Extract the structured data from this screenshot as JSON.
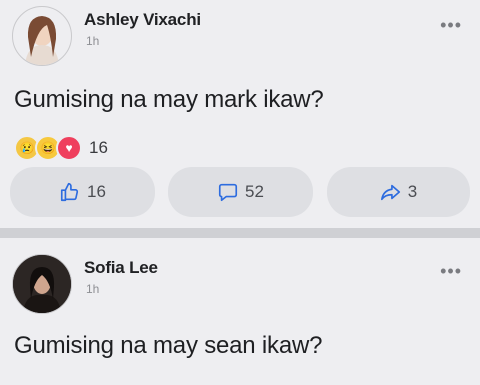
{
  "posts": [
    {
      "author": "Ashley Vixachi",
      "time": "1h",
      "text": "Gumising na may mark ikaw?",
      "reactions": {
        "icons": [
          "sad-face-icon",
          "laughing-face-icon",
          "heart-icon"
        ],
        "count": "16"
      },
      "actions": {
        "like_count": "16",
        "comment_count": "52",
        "share_count": "3"
      }
    },
    {
      "author": "Sofia Lee",
      "time": "1h",
      "text": "Gumising na may sean ikaw?"
    }
  ],
  "colors": {
    "post_background": "#eeeef1",
    "action_background": "#dedfe3",
    "divider": "#cfd0d4"
  }
}
